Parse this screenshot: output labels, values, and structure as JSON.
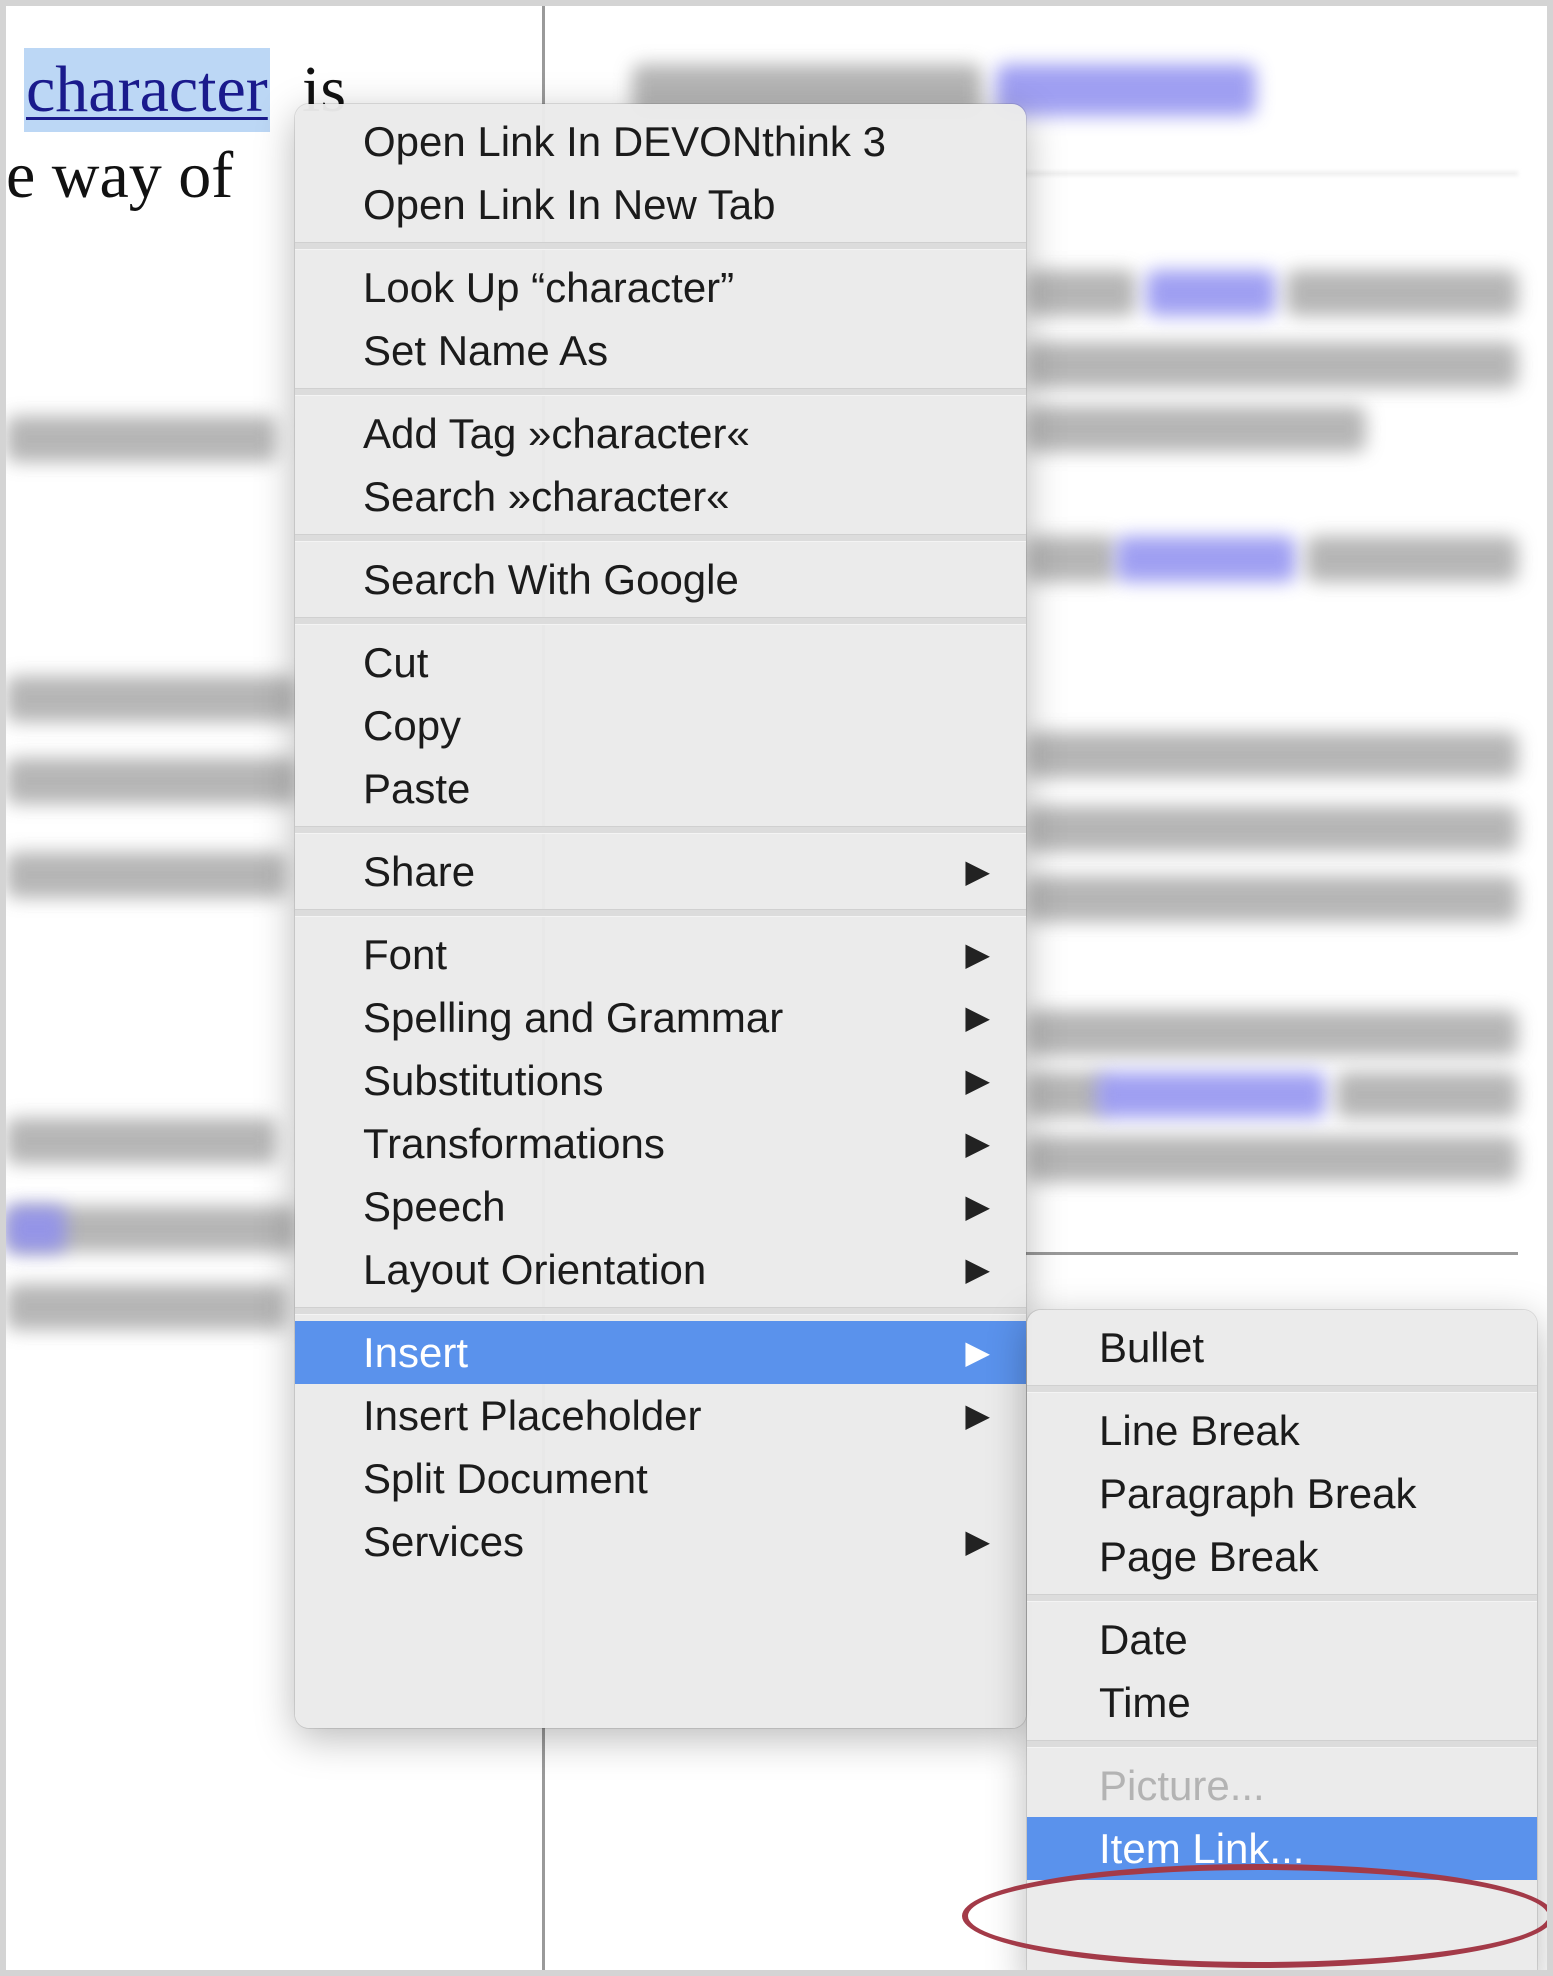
{
  "document": {
    "selected_word": "character",
    "line1_suffix": " is",
    "line2_fragment": "e way of"
  },
  "context_menu": {
    "groups": [
      [
        {
          "id": "open-link-devonthink",
          "label": "Open Link In DEVONthink 3",
          "submenu": false
        },
        {
          "id": "open-link-new-tab",
          "label": "Open Link In New Tab",
          "submenu": false
        }
      ],
      [
        {
          "id": "look-up",
          "label": "Look Up “character”",
          "submenu": false
        },
        {
          "id": "set-name-as",
          "label": "Set Name As",
          "submenu": false
        }
      ],
      [
        {
          "id": "add-tag",
          "label": "Add Tag »character«",
          "submenu": false
        },
        {
          "id": "search-character",
          "label": "Search »character«",
          "submenu": false
        }
      ],
      [
        {
          "id": "search-google",
          "label": "Search With Google",
          "submenu": false
        }
      ],
      [
        {
          "id": "cut",
          "label": "Cut",
          "submenu": false
        },
        {
          "id": "copy",
          "label": "Copy",
          "submenu": false
        },
        {
          "id": "paste",
          "label": "Paste",
          "submenu": false
        }
      ],
      [
        {
          "id": "share",
          "label": "Share",
          "submenu": true
        }
      ],
      [
        {
          "id": "font",
          "label": "Font",
          "submenu": true
        },
        {
          "id": "spelling-grammar",
          "label": "Spelling and Grammar",
          "submenu": true
        },
        {
          "id": "substitutions",
          "label": "Substitutions",
          "submenu": true
        },
        {
          "id": "transformations",
          "label": "Transformations",
          "submenu": true
        },
        {
          "id": "speech",
          "label": "Speech",
          "submenu": true
        },
        {
          "id": "layout-orientation",
          "label": "Layout Orientation",
          "submenu": true
        }
      ],
      [
        {
          "id": "insert",
          "label": "Insert",
          "submenu": true,
          "selected": true
        },
        {
          "id": "insert-placeholder",
          "label": "Insert Placeholder",
          "submenu": true
        },
        {
          "id": "split-document",
          "label": "Split Document",
          "submenu": false
        },
        {
          "id": "services",
          "label": "Services",
          "submenu": true
        }
      ]
    ]
  },
  "insert_submenu": {
    "groups": [
      [
        {
          "id": "bullet",
          "label": "Bullet"
        }
      ],
      [
        {
          "id": "line-break",
          "label": "Line Break"
        },
        {
          "id": "paragraph-break",
          "label": "Paragraph Break"
        },
        {
          "id": "page-break",
          "label": "Page Break"
        }
      ],
      [
        {
          "id": "date",
          "label": "Date"
        },
        {
          "id": "time",
          "label": "Time"
        }
      ],
      [
        {
          "id": "picture",
          "label": "Picture...",
          "disabled": true
        },
        {
          "id": "item-link",
          "label": "Item Link...",
          "selected": true
        }
      ]
    ]
  },
  "colors": {
    "selection_highlight": "#5a92ec",
    "annotation_ellipse": "#a33a48",
    "selected_text_background": "#bcd7f5"
  }
}
